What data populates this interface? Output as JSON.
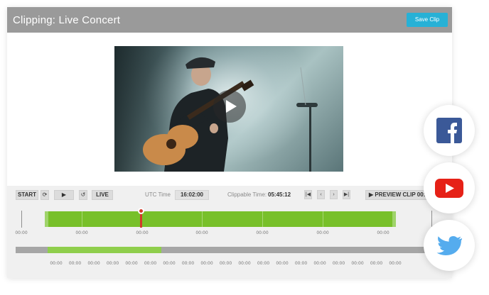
{
  "header": {
    "title": "Clipping: Live Concert",
    "save_label": "Save Clip"
  },
  "controls": {
    "start_label": "START",
    "live_label": "LIVE",
    "utc_label": "UTC Time",
    "utc_value": "16:02:00",
    "clippable_label": "Clippable Time:",
    "clippable_value": "05:45:12",
    "preview_label": "▶ PREVIEW CLIP 00:"
  },
  "timeline": {
    "ticks": [
      "00:00",
      "00:00",
      "00:00",
      "00:00",
      "00:00",
      "00:00",
      "00:00"
    ]
  },
  "track": {
    "ticks": [
      "00:00",
      "00:00",
      "00:00",
      "00:00",
      "00:00",
      "00:00",
      "00:00",
      "00:00",
      "00:00",
      "00:00",
      "00:00",
      "00:00",
      "00:00",
      "00:00",
      "00:00",
      "00:00",
      "00:00",
      "00:00",
      "00:00"
    ]
  },
  "colors": {
    "accent": "#27b1d6",
    "clip_green": "#78c02a",
    "playhead": "#d23a2a",
    "facebook": "#3b5998",
    "youtube": "#e62117",
    "twitter": "#55acee"
  },
  "social": [
    "facebook-icon",
    "youtube-icon",
    "twitter-icon"
  ]
}
